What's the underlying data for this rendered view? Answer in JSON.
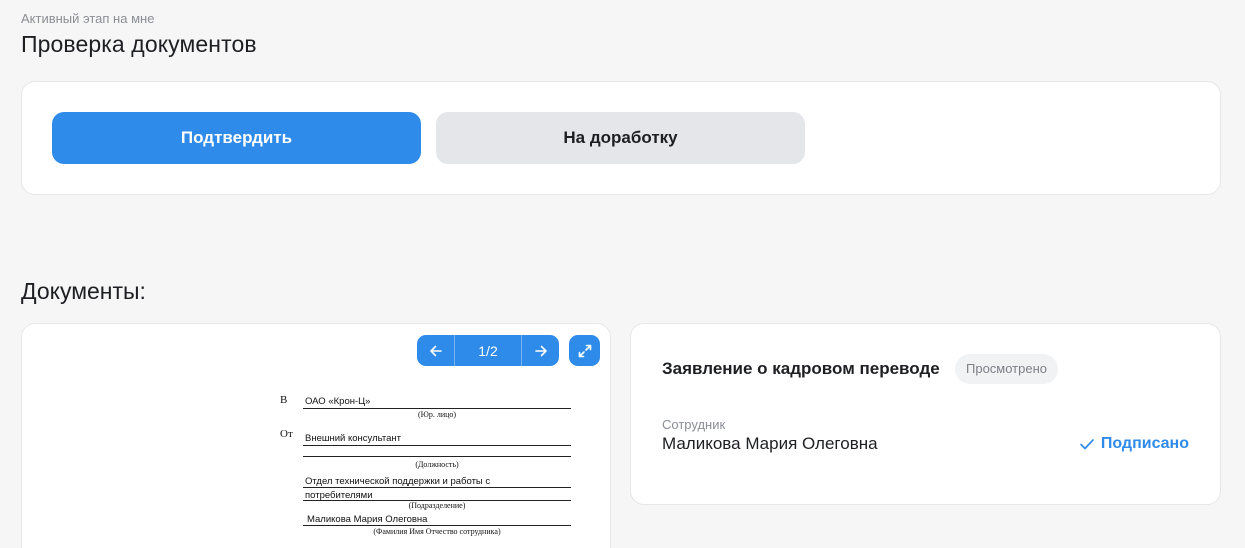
{
  "header": {
    "stage_label": "Активный этап на мне",
    "title": "Проверка документов"
  },
  "actions": {
    "confirm_label": "Подтвердить",
    "rework_label": "На доработку"
  },
  "documents": {
    "title": "Документы:",
    "preview": {
      "page_indicator": "1/2",
      "prev_icon": "arrow-left-icon",
      "next_icon": "arrow-right-icon",
      "expand_icon": "expand-icon",
      "form": {
        "to_label": "В",
        "to_value": "ОАО «Крон-Ц»",
        "to_caption": "(Юр. лицо)",
        "from_label": "От",
        "position_value": "Внешний консультант",
        "position_caption": "(Должность)",
        "department_line1": "Отдел технической поддержки и работы с",
        "department_line2": "потребителями",
        "department_caption": "(Подразделение)",
        "employee_value": "Маликова Мария Олеговна",
        "employee_caption": "(Фамилия Имя Отчество сотрудника)"
      }
    },
    "item": {
      "name": "Заявление о кадровом переводе",
      "status_badge": "Просмотрено",
      "employee_label": "Сотрудник",
      "employee_name": "Маликова Мария Олеговна",
      "signed_label": "Подписано",
      "signed_icon": "check-icon"
    }
  },
  "colors": {
    "accent": "#2f8be9",
    "background": "#f6f6f7",
    "secondary_button": "#e4e6ea"
  }
}
